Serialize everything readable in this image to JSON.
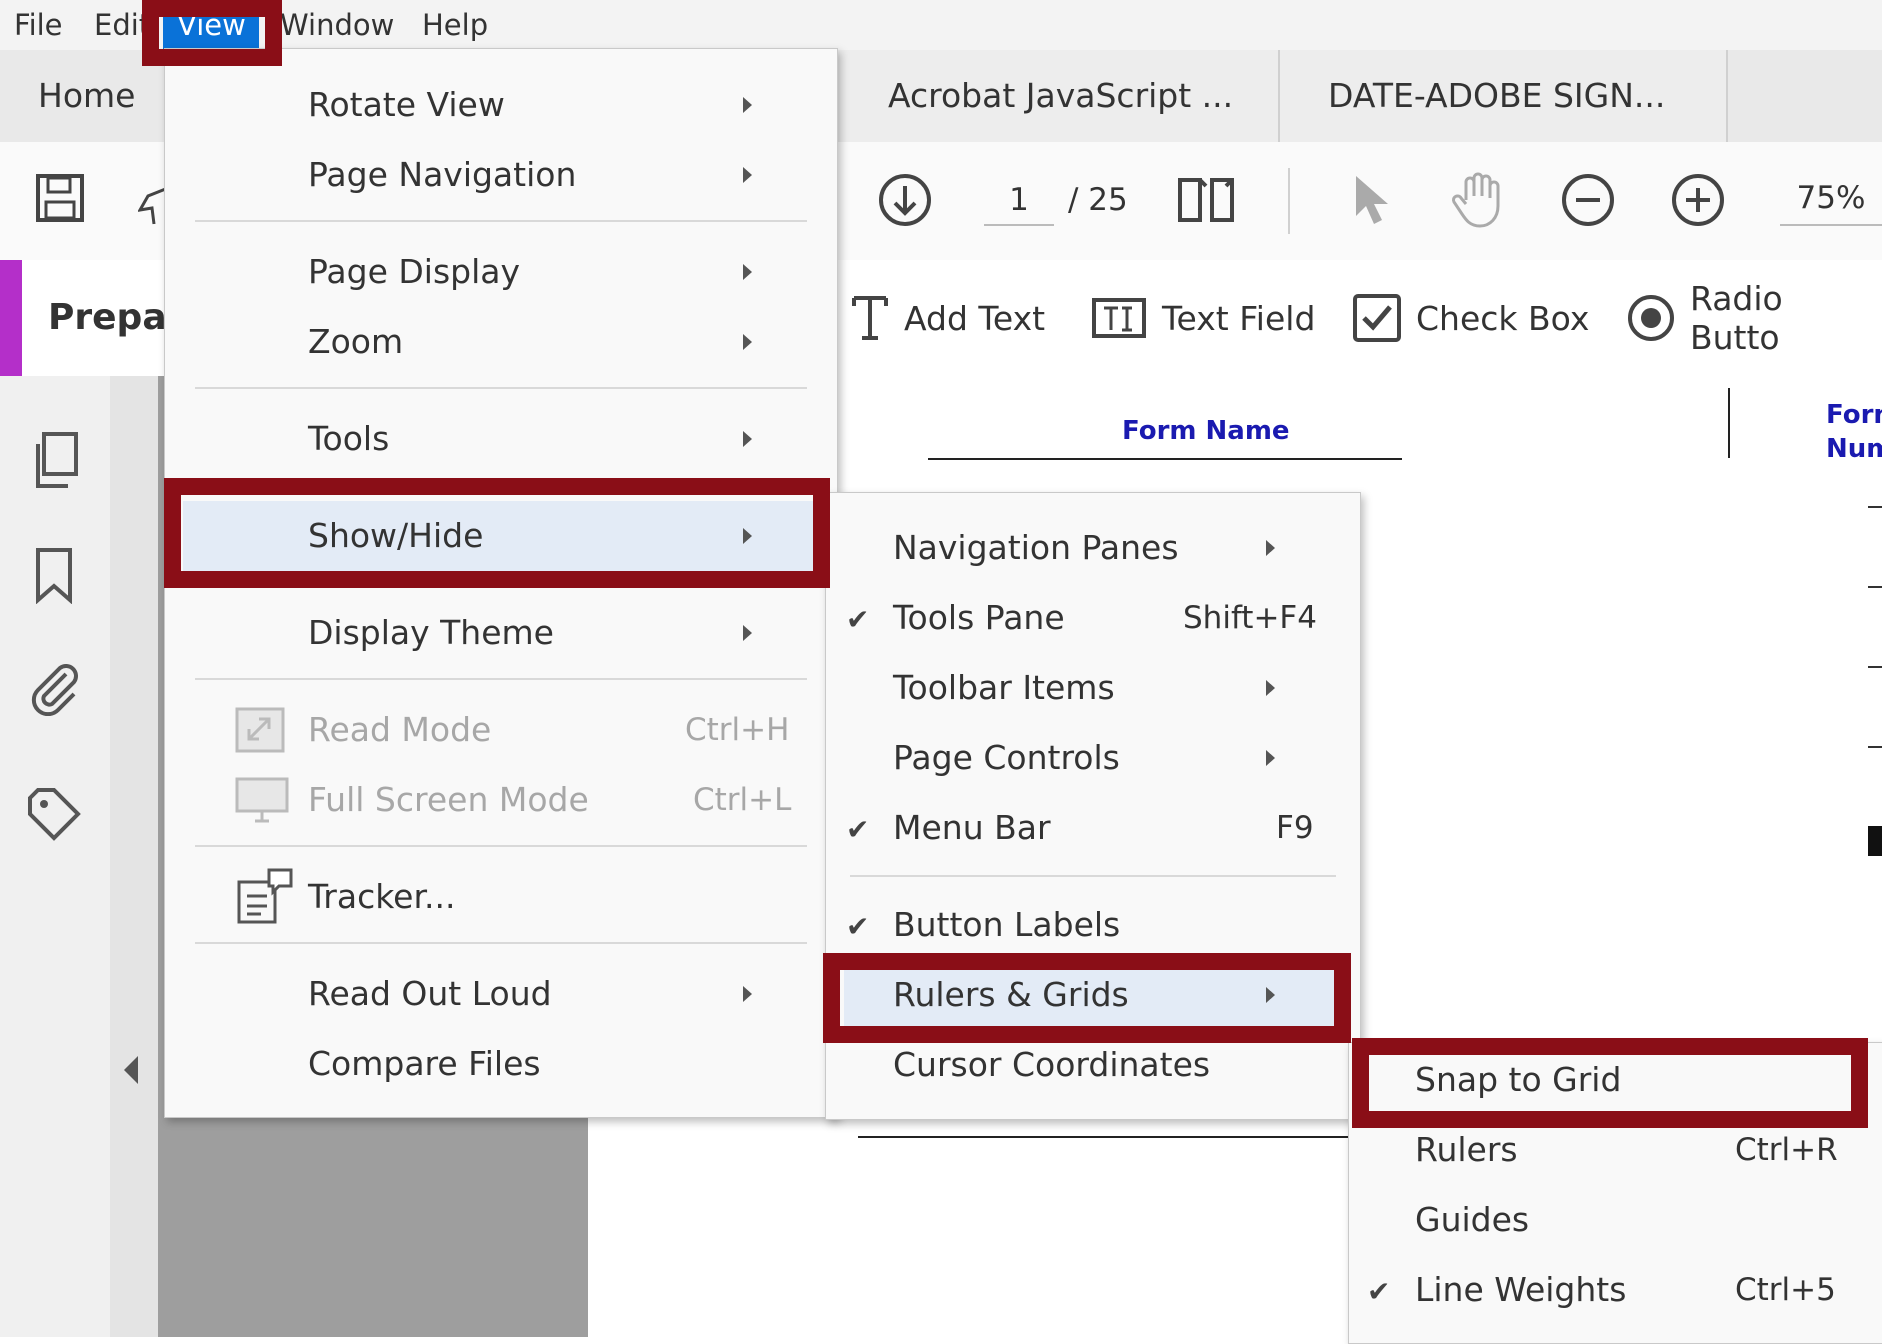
{
  "menubar": {
    "items": [
      "File",
      "Edit",
      "View",
      "Window",
      "Help"
    ]
  },
  "tabs": {
    "home": "Home",
    "doc1": "Acrobat JavaScript ...",
    "doc2": "DATE-ADOBE SIGN..."
  },
  "toolbar": {
    "page_current": "1",
    "page_total": "/ 25",
    "zoom": "75%"
  },
  "prepare": {
    "title": "Prepar",
    "tools": [
      "Add Text",
      "Text Field",
      "Check Box",
      "Radio Butto"
    ]
  },
  "document": {
    "form_name": "Form Name",
    "form_number_1": "Form",
    "form_number_2": "Numb"
  },
  "view_menu": {
    "rotate_view": "Rotate View",
    "page_navigation": "Page Navigation",
    "page_display": "Page Display",
    "zoom": "Zoom",
    "tools": "Tools",
    "show_hide": "Show/Hide",
    "display_theme": "Display Theme",
    "read_mode": "Read Mode",
    "read_mode_sc": "Ctrl+H",
    "full_screen": "Full Screen Mode",
    "full_screen_sc": "Ctrl+L",
    "tracker": "Tracker...",
    "read_out_loud": "Read Out Loud",
    "compare_files": "Compare Files"
  },
  "showhide_menu": {
    "navigation_panes": "Navigation Panes",
    "tools_pane": "Tools Pane",
    "tools_pane_sc": "Shift+F4",
    "toolbar_items": "Toolbar Items",
    "page_controls": "Page Controls",
    "menu_bar": "Menu Bar",
    "menu_bar_sc": "F9",
    "button_labels": "Button Labels",
    "rulers_grids": "Rulers & Grids",
    "cursor_coordinates": "Cursor Coordinates"
  },
  "rulers_menu": {
    "snap_to_grid": "Snap to Grid",
    "rulers": "Rulers",
    "rulers_sc": "Ctrl+R",
    "guides": "Guides",
    "line_weights": "Line Weights",
    "line_weights_sc": "Ctrl+5"
  },
  "colors": {
    "highlight_frame": "#8a0e17",
    "menu_selected": "#0a72d8",
    "prepare_accent": "#b42fc9",
    "form_label": "#1a1ab0"
  }
}
